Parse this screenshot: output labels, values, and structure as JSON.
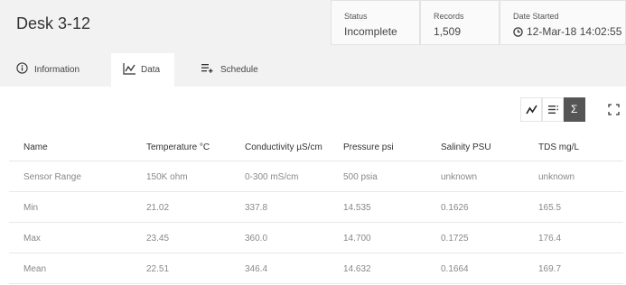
{
  "header": {
    "title": "Desk 3-12",
    "status": {
      "label": "Status",
      "value": "Incomplete"
    },
    "records": {
      "label": "Records",
      "value": "1,509"
    },
    "date_started": {
      "label": "Date Started",
      "value": "12-Mar-18 14:02:55",
      "icon": "clock-icon"
    }
  },
  "tabs": [
    {
      "label": "Information",
      "icon": "info-circle-icon",
      "active": false
    },
    {
      "label": "Data",
      "icon": "chart-icon",
      "active": true
    },
    {
      "label": "Schedule",
      "icon": "schedule-icon",
      "active": false
    }
  ],
  "toolbar": [
    {
      "icon": "line-chart-icon",
      "active": false
    },
    {
      "icon": "list-icon",
      "active": false
    },
    {
      "icon": "sigma-icon",
      "active": true,
      "label": "Σ"
    },
    {
      "icon": "expand-icon",
      "active": false
    }
  ],
  "table": {
    "columns": [
      "Name",
      "Temperature °C",
      "Conductivity µS/cm",
      "Pressure psi",
      "Salinity PSU",
      "TDS mg/L"
    ],
    "rows": [
      [
        "Sensor Range",
        "150K ohm",
        "0-300 mS/cm",
        "500 psia",
        "unknown",
        "unknown"
      ],
      [
        "Min",
        "21.02",
        "337.8",
        "14.535",
        "0.1626",
        "165.5"
      ],
      [
        "Max",
        "23.45",
        "360.0",
        "14.700",
        "0.1725",
        "176.4"
      ],
      [
        "Mean",
        "22.51",
        "346.4",
        "14.632",
        "0.1664",
        "169.7"
      ]
    ]
  },
  "colors": {
    "header_bg": "#f2f2f2",
    "active_tool_bg": "#555555",
    "muted_text": "#888888"
  }
}
